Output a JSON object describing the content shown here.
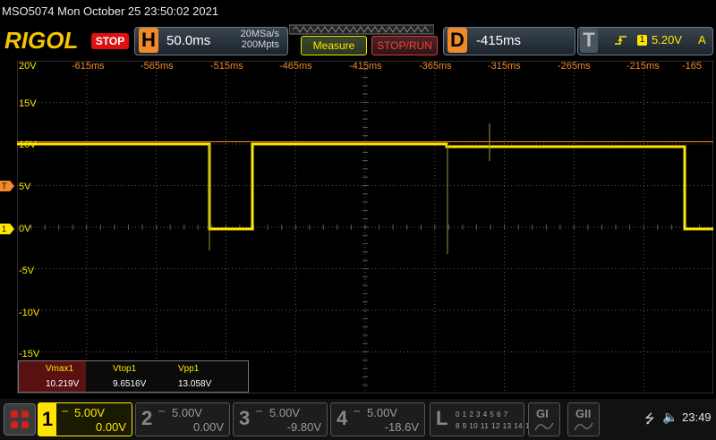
{
  "device_info": "MSO5074  Mon October 25 23:50:02 2021",
  "brand": "RIGOL",
  "run_state": "STOP",
  "horizontal": {
    "letter": "H",
    "timebase": "50.0ms",
    "sample_rate": "20MSa/s",
    "memory_depth": "200Mpts"
  },
  "buttons": {
    "measure": "Measure",
    "stop_run": "STOP/RUN"
  },
  "delay": {
    "letter": "D",
    "value": "-415ms"
  },
  "trigger": {
    "letter": "T",
    "source": "1",
    "level": "5.20V",
    "mode": "A"
  },
  "time_labels": [
    "-615ms",
    "-565ms",
    "-515ms",
    "-465ms",
    "-415ms",
    "-365ms",
    "-315ms",
    "-265ms",
    "-215ms",
    "-165"
  ],
  "volt_labels": [
    "20V",
    "15V",
    "10V",
    "5V",
    "0V",
    "-5V",
    "-10V",
    "-15V"
  ],
  "markers": {
    "ch1": "1",
    "trigger": "T"
  },
  "measurements": [
    {
      "label": "Vmax1",
      "value": "10.219V"
    },
    {
      "label": "Vtop1",
      "value": "9.6516V"
    },
    {
      "label": "Vpp1",
      "value": "13.058V"
    }
  ],
  "channels": [
    {
      "num": "1",
      "scale": "5.00V",
      "offset": "0.00V"
    },
    {
      "num": "2",
      "scale": "5.00V",
      "offset": "0.00V"
    },
    {
      "num": "3",
      "scale": "5.00V",
      "offset": "-9.80V"
    },
    {
      "num": "4",
      "scale": "5.00V",
      "offset": "-18.6V"
    }
  ],
  "logic": {
    "label": "L",
    "bits_row1": "0 1 2 3 4 5 6 7",
    "bits_row2": "8 9 10 11 12 13 14 15"
  },
  "decoders": [
    "GI",
    "GII"
  ],
  "clock": "23:49",
  "colors": {
    "ch1": "#ffe600",
    "trigger": "#f08a28",
    "stop": "#dd1111",
    "grid": "#5a5a5a"
  },
  "icons": {
    "menu": "menu-grid-icon",
    "usb": "usb-icon",
    "speaker": "speaker-icon",
    "edge": "rising-edge-icon"
  }
}
